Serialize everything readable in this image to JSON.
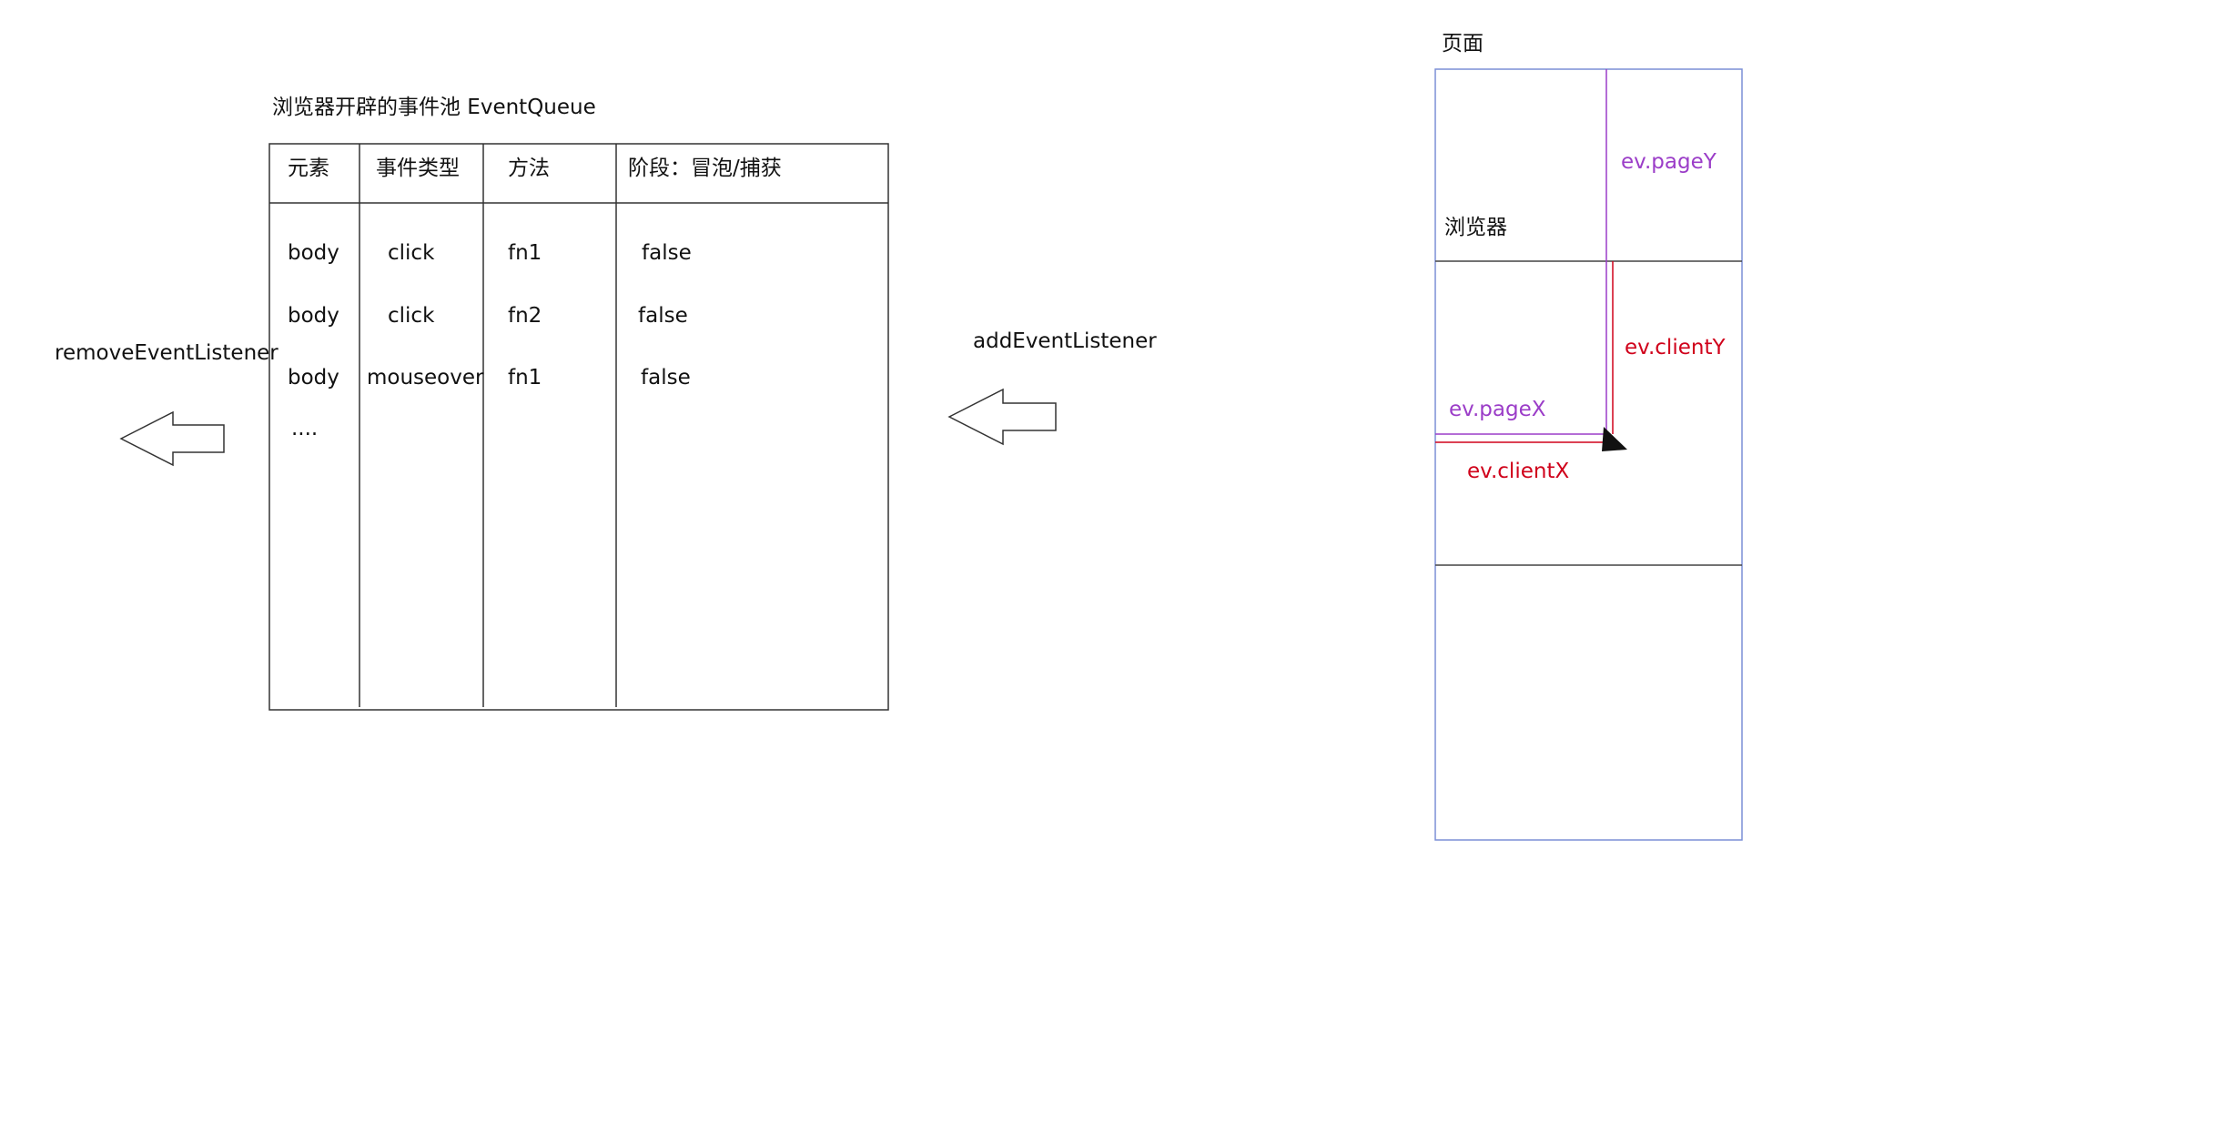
{
  "event_pool": {
    "title": "浏览器开辟的事件池  EventQueue",
    "columns": [
      "元素",
      "事件类型",
      "方法",
      "阶段：冒泡/捕获"
    ],
    "rows": [
      [
        "body",
        "click",
        "fn1",
        "false"
      ],
      [
        "body",
        "click",
        "fn2",
        "false"
      ],
      [
        "body",
        "mouseover",
        "fn1",
        "false"
      ]
    ],
    "ellipsis": "...."
  },
  "arrows": {
    "remove_label": "removeEventListener",
    "add_label": "addEventListener"
  },
  "page_diagram": {
    "page_label": "页面",
    "browser_label": "浏览器",
    "page_y": "ev.pageY",
    "client_y": "ev.clientY",
    "page_x": "ev.pageX",
    "client_x": "ev.clientX"
  },
  "colors": {
    "table_border": "#333333",
    "page_border": "#7b8fd6",
    "page_axis": "#9b3dc8",
    "client_axis": "#d0021b",
    "pointer": "#111111"
  }
}
